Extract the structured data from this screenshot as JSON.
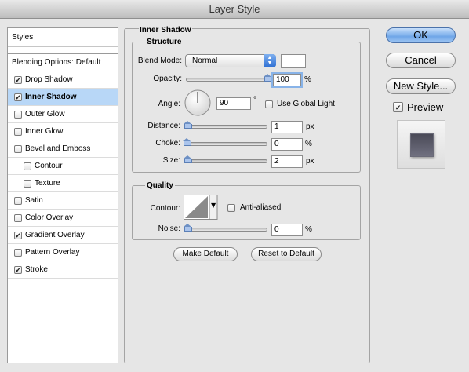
{
  "window": {
    "title": "Layer Style"
  },
  "styles_list": {
    "header": "Styles",
    "blending": "Blending Options: Default",
    "items": [
      {
        "label": "Drop Shadow",
        "checked": true,
        "sub": false,
        "selected": false
      },
      {
        "label": "Inner Shadow",
        "checked": true,
        "sub": false,
        "selected": true
      },
      {
        "label": "Outer Glow",
        "checked": false,
        "sub": false,
        "selected": false
      },
      {
        "label": "Inner Glow",
        "checked": false,
        "sub": false,
        "selected": false
      },
      {
        "label": "Bevel and Emboss",
        "checked": false,
        "sub": false,
        "selected": false
      },
      {
        "label": "Contour",
        "checked": false,
        "sub": true,
        "selected": false
      },
      {
        "label": "Texture",
        "checked": false,
        "sub": true,
        "selected": false
      },
      {
        "label": "Satin",
        "checked": false,
        "sub": false,
        "selected": false
      },
      {
        "label": "Color Overlay",
        "checked": false,
        "sub": false,
        "selected": false
      },
      {
        "label": "Gradient Overlay",
        "checked": true,
        "sub": false,
        "selected": false
      },
      {
        "label": "Pattern Overlay",
        "checked": false,
        "sub": false,
        "selected": false
      },
      {
        "label": "Stroke",
        "checked": true,
        "sub": false,
        "selected": false
      }
    ]
  },
  "panel": {
    "title": "Inner Shadow",
    "structure": {
      "title": "Structure",
      "blend_mode_label": "Blend Mode:",
      "blend_mode_value": "Normal",
      "opacity_label": "Opacity:",
      "opacity_value": "100",
      "opacity_unit": "%",
      "opacity_level": 1.0,
      "angle_label": "Angle:",
      "angle_value": "90",
      "angle_unit": "°",
      "use_global_light_label": "Use Global Light",
      "use_global_light_checked": false,
      "distance_label": "Distance:",
      "distance_value": "1",
      "distance_unit": "px",
      "choke_label": "Choke:",
      "choke_value": "0",
      "choke_unit": "%",
      "size_label": "Size:",
      "size_value": "2",
      "size_unit": "px"
    },
    "quality": {
      "title": "Quality",
      "contour_label": "Contour:",
      "anti_aliased_label": "Anti-aliased",
      "anti_aliased_checked": false,
      "noise_label": "Noise:",
      "noise_value": "0",
      "noise_unit": "%"
    },
    "make_default_label": "Make Default",
    "reset_default_label": "Reset to Default"
  },
  "actions": {
    "ok_label": "OK",
    "cancel_label": "Cancel",
    "new_style_label": "New Style...",
    "preview_label": "Preview",
    "preview_checked": true
  },
  "colors": {
    "selection": "#b8d7f7",
    "accent": "#2d6ed3",
    "preview_swatch": "#5a5a68"
  }
}
